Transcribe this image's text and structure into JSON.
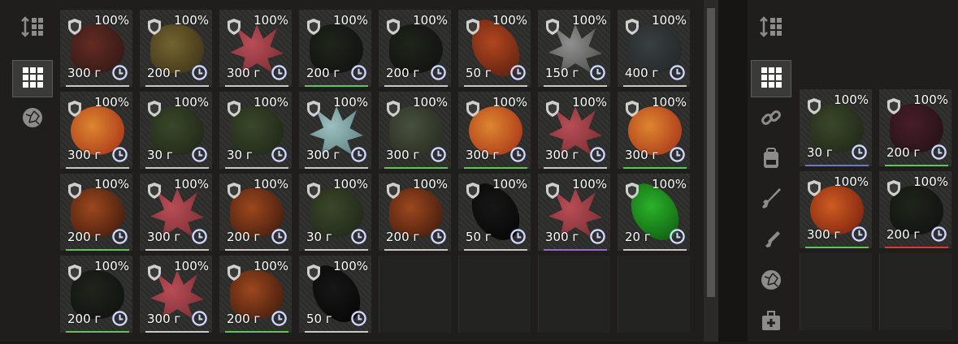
{
  "left_sidebar": {
    "buttons": [
      {
        "name": "sort-icon",
        "active": false
      },
      {
        "name": "grid-view-icon",
        "active": true
      },
      {
        "name": "artifact-filter-icon",
        "active": false
      }
    ]
  },
  "left_grid": {
    "items": [
      {
        "pct": "100%",
        "weight": "300 г",
        "art": "blob",
        "c1": "#6a2a22",
        "c2": "#2a1410",
        "bar": "#c8c8c8"
      },
      {
        "pct": "100%",
        "weight": "200 г",
        "art": "blob",
        "c1": "#7a6a30",
        "c2": "#3a2e12",
        "bar": "#c8c8c8"
      },
      {
        "pct": "100%",
        "weight": "300 г",
        "art": "shard",
        "c1": "#c8505a",
        "c2": "#7a2a30",
        "bar": "#c8c8c8"
      },
      {
        "pct": "100%",
        "weight": "200 г",
        "art": "blob",
        "c1": "#1c2418",
        "c2": "#0c0c0a",
        "bar": "#5fc45a"
      },
      {
        "pct": "100%",
        "weight": "200 г",
        "art": "blob",
        "c1": "#1c2418",
        "c2": "#0c0c0a",
        "bar": "#c8c8c8"
      },
      {
        "pct": "100%",
        "weight": "50 г",
        "art": "leaf",
        "c1": "#c0481e",
        "c2": "#5a1c0c",
        "bar": "#c8c8c8"
      },
      {
        "pct": "100%",
        "weight": "150 г",
        "art": "shard",
        "c1": "#9a9a9a",
        "c2": "#4a4a4a",
        "bar": "#c8c8c8"
      },
      {
        "pct": "100%",
        "weight": "400 г",
        "art": "blob",
        "c1": "#3a4244",
        "c2": "#1e2224",
        "bar": "#c8c8c8"
      },
      {
        "pct": "100%",
        "weight": "300 г",
        "art": "spiral",
        "c1": "#f09030",
        "c2": "#b02a14",
        "bar": "#c8c8c8"
      },
      {
        "pct": "100%",
        "weight": "30 г",
        "art": "blob",
        "c1": "#3c4a2a",
        "c2": "#1a2212",
        "bar": "#c8c8c8"
      },
      {
        "pct": "100%",
        "weight": "30 г",
        "art": "blob",
        "c1": "#3c4a2a",
        "c2": "#1a2212",
        "bar": "#c8c8c8"
      },
      {
        "pct": "100%",
        "weight": "300 г",
        "art": "shard",
        "c1": "#a8d0d0",
        "c2": "#5a8080",
        "bar": "#c8c8c8"
      },
      {
        "pct": "100%",
        "weight": "300 г",
        "art": "blob",
        "c1": "#4a5440",
        "c2": "#22281c",
        "bar": "#5fc45a"
      },
      {
        "pct": "100%",
        "weight": "300 г",
        "art": "spiral",
        "c1": "#f09030",
        "c2": "#b02a14",
        "bar": "#5fc45a"
      },
      {
        "pct": "100%",
        "weight": "300 г",
        "art": "shard",
        "c1": "#c8505a",
        "c2": "#7a2a30",
        "bar": "#c8c8c8"
      },
      {
        "pct": "100%",
        "weight": "300 г",
        "art": "spiral",
        "c1": "#f09030",
        "c2": "#b02a14",
        "bar": "#5fc45a"
      },
      {
        "pct": "100%",
        "weight": "200 г",
        "art": "blob",
        "c1": "#a84a1c",
        "c2": "#3a1408",
        "bar": "#5fc45a"
      },
      {
        "pct": "100%",
        "weight": "300 г",
        "art": "shard",
        "c1": "#c8505a",
        "c2": "#7a2a30",
        "bar": "#c8c8c8"
      },
      {
        "pct": "100%",
        "weight": "200 г",
        "art": "blob",
        "c1": "#a84a1c",
        "c2": "#3a1408",
        "bar": "#c8c8c8"
      },
      {
        "pct": "100%",
        "weight": "30 г",
        "art": "blob",
        "c1": "#3c4a2a",
        "c2": "#1a2212",
        "bar": "#c8c8c8"
      },
      {
        "pct": "100%",
        "weight": "200 г",
        "art": "blob",
        "c1": "#a84a1c",
        "c2": "#3a1408",
        "bar": "#c8c8c8"
      },
      {
        "pct": "100%",
        "weight": "50 г",
        "art": "leaf",
        "c1": "#141414",
        "c2": "#000000",
        "bar": "#c8c8c8"
      },
      {
        "pct": "100%",
        "weight": "300 г",
        "art": "shard",
        "c1": "#c8505a",
        "c2": "#7a2a30",
        "bar": "#9a6ac8"
      },
      {
        "pct": "100%",
        "weight": "20 г",
        "art": "leaf",
        "c1": "#2ac02a",
        "c2": "#0a5a0a",
        "bar": "#c8c8c8"
      },
      {
        "pct": "100%",
        "weight": "200 г",
        "art": "blob",
        "c1": "#1c2418",
        "c2": "#0c0c0a",
        "bar": "#5fc45a"
      },
      {
        "pct": "100%",
        "weight": "300 г",
        "art": "shard",
        "c1": "#c8505a",
        "c2": "#7a2a30",
        "bar": "#c8c8c8"
      },
      {
        "pct": "100%",
        "weight": "200 г",
        "art": "blob",
        "c1": "#a84a1c",
        "c2": "#3a1408",
        "bar": "#5fc45a"
      },
      {
        "pct": "100%",
        "weight": "50 г",
        "art": "leaf",
        "c1": "#141414",
        "c2": "#000000",
        "bar": "#c8c8c8"
      }
    ]
  },
  "right_sidebar": {
    "buttons": [
      {
        "name": "sort-icon",
        "active": false
      },
      {
        "name": "grid-view-icon",
        "active": true
      },
      {
        "name": "chain-icon",
        "active": false
      },
      {
        "name": "backpack-icon",
        "active": false
      },
      {
        "name": "rifle-icon",
        "active": false
      },
      {
        "name": "pistol-icon",
        "active": false
      },
      {
        "name": "artifact-filter-icon",
        "active": false
      },
      {
        "name": "medkit-icon",
        "active": false
      }
    ]
  },
  "right_grid": {
    "items": [
      {
        "pct": "100%",
        "weight": "30 г",
        "art": "blob",
        "c1": "#3c4a2a",
        "c2": "#1a2212",
        "bar": "#6a7ac8"
      },
      {
        "pct": "100%",
        "weight": "200 г",
        "art": "blob",
        "c1": "#4a1c2a",
        "c2": "#1e0c12",
        "bar": "#5fc45a"
      },
      {
        "pct": "100%",
        "weight": "300 г",
        "art": "spiral",
        "c1": "#e06020",
        "c2": "#7a1a0a",
        "bar": "#5fc45a"
      },
      {
        "pct": "100%",
        "weight": "200 г",
        "art": "blob",
        "c1": "#1c2418",
        "c2": "#0c0c0a",
        "bar": "#d83a3a"
      }
    ]
  }
}
